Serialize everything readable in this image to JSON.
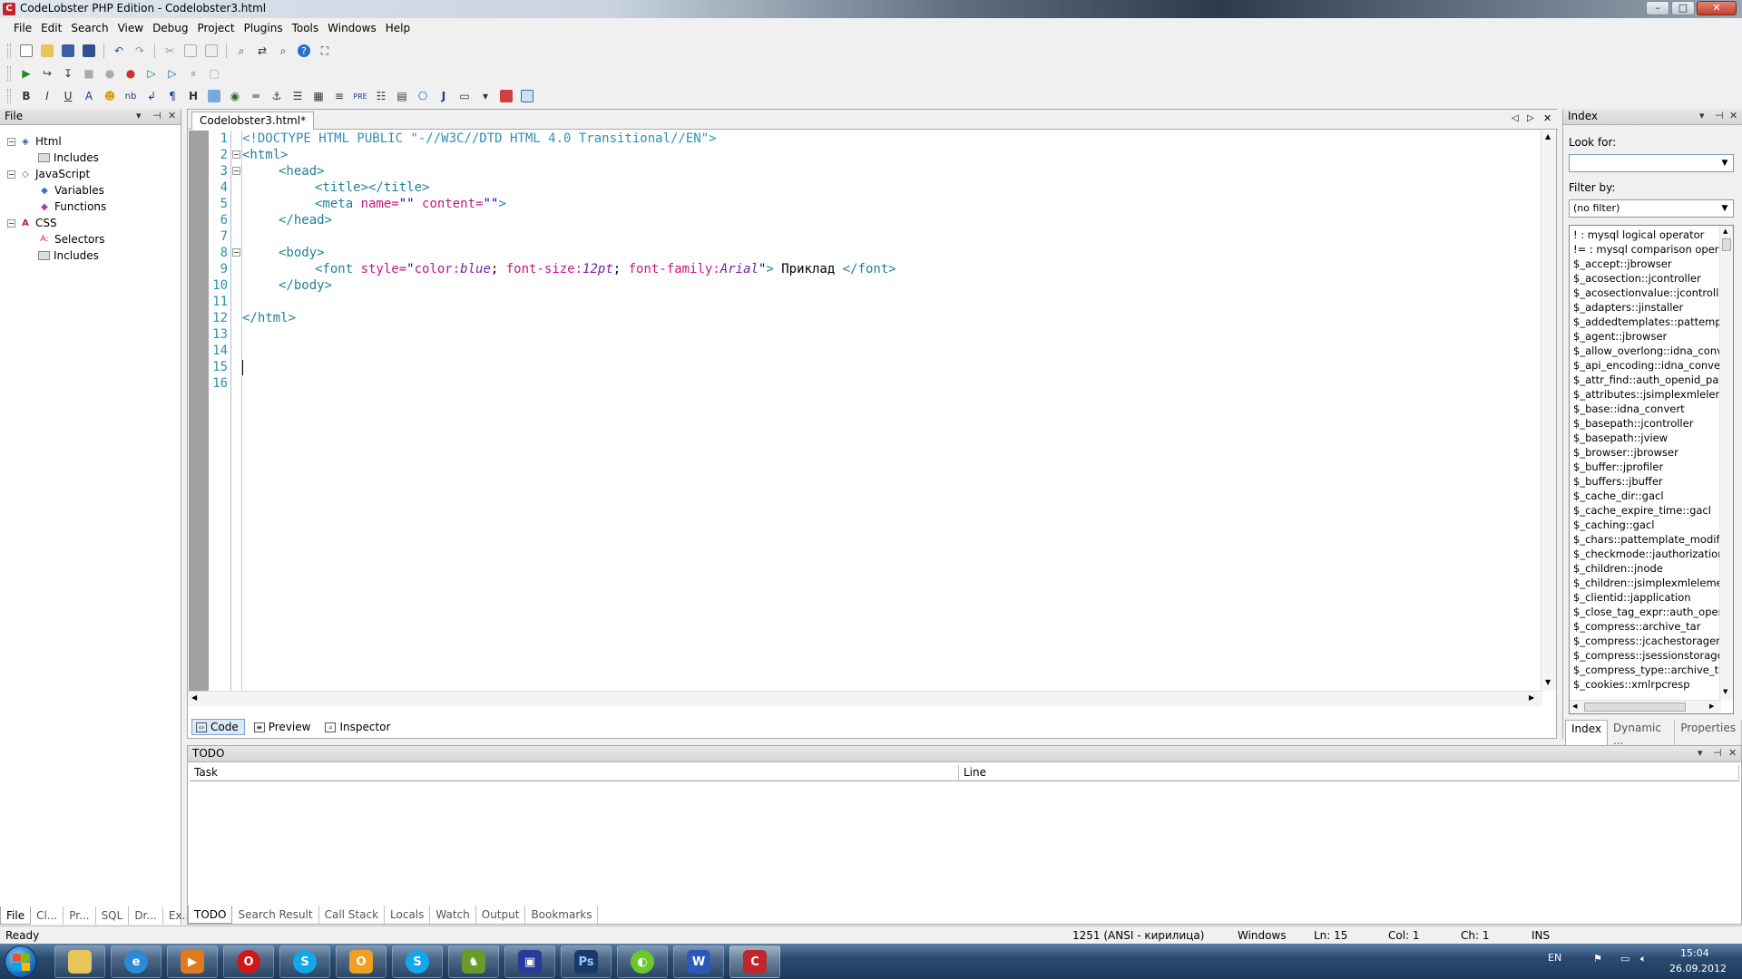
{
  "window": {
    "title": "CodeLobster PHP Edition - Codelobster3.html",
    "app_icon": "codelobster-icon",
    "buttons": {
      "minimize": "–",
      "maximize": "□",
      "close": "✕"
    }
  },
  "menu": [
    "File",
    "Edit",
    "Search",
    "View",
    "Debug",
    "Project",
    "Plugins",
    "Tools",
    "Windows",
    "Help"
  ],
  "toolbar_html": {
    "bold": "B",
    "italic": "I",
    "underline": "U",
    "font": "A",
    "nb": "nb",
    "para": "¶",
    "heading": "H",
    "pre": "PRE",
    "j": "J"
  },
  "left_panel": {
    "title": "File",
    "tree": [
      {
        "label": "Html",
        "level": 0,
        "expander": "−",
        "icon": "html-icon"
      },
      {
        "label": "Includes",
        "level": 1,
        "icon": "includes-icon"
      },
      {
        "label": "JavaScript",
        "level": 0,
        "expander": "−",
        "icon": "javascript-icon"
      },
      {
        "label": "Variables",
        "level": 1,
        "icon": "variable-icon"
      },
      {
        "label": "Functions",
        "level": 1,
        "icon": "function-icon"
      },
      {
        "label": "CSS",
        "level": 0,
        "expander": "−",
        "icon": "css-icon"
      },
      {
        "label": "Selectors",
        "level": 1,
        "icon": "selector-icon"
      },
      {
        "label": "Includes",
        "level": 1,
        "icon": "includes-icon"
      }
    ],
    "tabs": [
      "File",
      "Cl...",
      "Pr...",
      "SQL",
      "Dr...",
      "Ex..."
    ]
  },
  "editor": {
    "tab_label": "Codelobster3.html*",
    "line_numbers": [
      "1",
      "2",
      "3",
      "4",
      "5",
      "6",
      "7",
      "8",
      "9",
      "10",
      "11",
      "12",
      "13",
      "14",
      "15",
      "16"
    ],
    "lines": {
      "l1": "<!DOCTYPE HTML PUBLIC \"-//W3C//DTD HTML 4.0 Transitional//EN\">",
      "l2": "<html>",
      "l3_tag": "<head>",
      "l4_tag": "<title></title>",
      "l5_open": "<meta ",
      "l5_attr1": "name=",
      "l5_val1": "\"\"",
      "l5_attr2": " content=",
      "l5_val2": "\"\"",
      "l5_close": ">",
      "l6_tag": "</head>",
      "l8_tag": "<body>",
      "l9_open": "<font ",
      "l9_attr": "style=",
      "l9_q1": "\"",
      "l9_p1": "color:",
      "l9_v1": "blue",
      "l9_s1": "; ",
      "l9_p2": "font-size:",
      "l9_v2": "12pt",
      "l9_s2": "; ",
      "l9_p3": "font-family:",
      "l9_v3": "Arial",
      "l9_q2": "\"",
      "l9_gt": ">",
      "l9_text": " Приклад ",
      "l9_close": "</font>",
      "l10_tag": "</body>",
      "l12_tag": "</html>"
    },
    "view_tabs": [
      "Code",
      "Preview",
      "Inspector"
    ]
  },
  "index_panel": {
    "title": "Index",
    "look_for_label": "Look for:",
    "look_for_value": "",
    "filter_label": "Filter by:",
    "filter_value": "(no filter)",
    "items": [
      "! : mysql logical operator",
      "!= : mysql comparison operato",
      "$_accept::jbrowser",
      "$_acosection::jcontroller",
      "$_acosectionvalue::jcontroller",
      "$_adapters::jinstaller",
      "$_addedtemplates::pattemplat",
      "$_agent::jbrowser",
      "$_allow_overlong::idna_conver",
      "$_api_encoding::idna_convert",
      "$_attr_find::auth_openid_parse",
      "$_attributes::jsimplexmlelemen",
      "$_base::idna_convert",
      "$_basepath::jcontroller",
      "$_basepath::jview",
      "$_browser::jbrowser",
      "$_buffer::jprofiler",
      "$_buffers::jbuffer",
      "$_cache_dir::gacl",
      "$_cache_expire_time::gacl",
      "$_caching::gacl",
      "$_chars::pattemplate_modifier",
      "$_checkmode::jauthorization",
      "$_children::jnode",
      "$_children::jsimplexmlelement",
      "$_clientid::japplication",
      "$_close_tag_expr::auth_openid",
      "$_compress::archive_tar",
      "$_compress::jcachestorageme",
      "$_compress::jsessionstoragem",
      "$_compress_type::archive_tar",
      "$_cookies::xmlrpcresp"
    ],
    "tabs": [
      "Index",
      "Dynamic ...",
      "Properties"
    ]
  },
  "todo_panel": {
    "title": "TODO",
    "columns": [
      "Task",
      "Line"
    ],
    "tabs": [
      "TODO",
      "Search Result",
      "Call Stack",
      "Locals",
      "Watch",
      "Output",
      "Bookmarks"
    ]
  },
  "status": {
    "ready": "Ready",
    "encoding": "1251 (ANSI - кирилица)",
    "line_ending": "Windows",
    "ln": "Ln: 15",
    "col": "Col: 1",
    "ch": "Ch: 1",
    "mode": "INS"
  },
  "taskbar": {
    "lang": "EN",
    "time": "15:04",
    "date": "26.09.2012",
    "apps": [
      "explorer",
      "internet-explorer",
      "media-player",
      "opera",
      "skype",
      "outlook",
      "skype",
      "game",
      "save-app",
      "photoshop",
      "browser",
      "word",
      "codelobster"
    ]
  }
}
